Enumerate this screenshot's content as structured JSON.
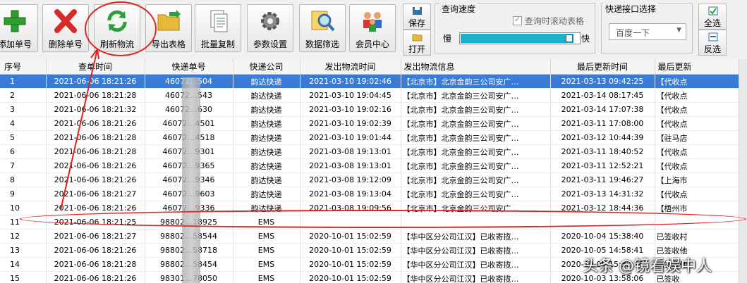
{
  "toolbar": {
    "buttons": [
      {
        "label": "添加单号",
        "icon": "plus-icon"
      },
      {
        "label": "删除单号",
        "icon": "x-icon"
      },
      {
        "label": "刷新物流",
        "icon": "refresh-icon"
      },
      {
        "label": "导出表格",
        "icon": "folder-export-icon"
      },
      {
        "label": "批量复制",
        "icon": "copy-icon"
      },
      {
        "label": "参数设置",
        "icon": "gear-icon"
      },
      {
        "label": "数据筛选",
        "icon": "magnifier-icon"
      },
      {
        "label": "会员中心",
        "icon": "members-icon"
      }
    ],
    "save_label": "保存",
    "open_label": "打开",
    "speed": {
      "title": "查询速度",
      "checkbox_label": "查询时滚动表格",
      "checked": true,
      "slow_label": "慢",
      "fast_label": "快",
      "level": 0.95
    },
    "interface": {
      "title": "快递接口选择",
      "selected": "百度一下"
    },
    "select_all_label": "全选",
    "invert_label": "反选"
  },
  "grid": {
    "headers": [
      "序号",
      "查单时间",
      "快递单号",
      "快递公司",
      "发出物流时间",
      "发出物流信息",
      "最后更新时间",
      "最后更新"
    ],
    "rows": [
      [
        "1",
        "2021-06-06 18:21:26",
        "46072…504",
        "韵达快递",
        "2021-03-10 19:02:46",
        "【北京市】北京金韵三公司安广…",
        "2021-03-13 09:42:25",
        "【代收点"
      ],
      [
        "2",
        "2021-06-06 18:21:28",
        "46072…543",
        "韵达快递",
        "2021-03-10 19:04:45",
        "【北京市】北京金韵三公司安广…",
        "2021-03-14 08:17:45",
        "【代收点"
      ],
      [
        "3",
        "2021-06-06 18:21:32",
        "46072…630",
        "韵达快递",
        "2021-03-10 19:02:16",
        "【北京市】北京金韵三公司安广…",
        "2021-03-14 17:07:38",
        "【代收点"
      ],
      [
        "4",
        "2021-06-06 18:21:26",
        "46072…4501",
        "韵达快递",
        "2021-03-10 19:02:39",
        "【北京市】北京金韵三公司安广…",
        "2021-03-11 17:08:00",
        "【代收点"
      ],
      [
        "5",
        "2021-06-06 18:21:28",
        "46072…4518",
        "韵达快递",
        "2021-03-10 19:01:44",
        "【北京市】北京金韵三公司安广…",
        "2021-03-12 10:44:39",
        "【驻马店"
      ],
      [
        "6",
        "2021-06-06 18:21:28",
        "46072…9301",
        "韵达快递",
        "2021-03-08 19:13:01",
        "【北京市】北京金韵三公司安广…",
        "2021-03-11 18:40:52",
        "【代收点"
      ],
      [
        "7",
        "2021-06-06 18:21:26",
        "46072…9365",
        "韵达快递",
        "2021-03-08 19:13:01",
        "【北京市】北京金韵三公司安广…",
        "2021-03-11 12:52:21",
        "【代收点"
      ],
      [
        "8",
        "2021-06-06 18:21:26",
        "46072…9346",
        "韵达快递",
        "2021-03-08 19:12:09",
        "【北京市】北京金韵三公司安广…",
        "2021-03-11 19:46:27",
        "【上海市"
      ],
      [
        "9",
        "2021-06-06 18:21:27",
        "46072…9603",
        "韵达快递",
        "2021-03-08 19:13:04",
        "【北京市】北京金韵三公司安广…",
        "2021-03-13 14:31:32",
        "【代收点"
      ],
      [
        "10",
        "2021-06-06 18:21:26",
        "46072…9336",
        "韵达快递",
        "2021-03-08 19:09:56",
        "【北京市】北京金韵三公司安广…",
        "2021-03-12 18:44:36",
        "【梧州市"
      ],
      [
        "11",
        "2021-06-06 18:21:25",
        "98802…18925",
        "EMS",
        "",
        "",
        "",
        ""
      ],
      [
        "12",
        "2021-06-06 18:21:27",
        "98802…58544",
        "EMS",
        "2020-10-01 15:02:59",
        "【华中区分公司江汉】已收寄揽…",
        "2020-10-04 15:38:40",
        "已签收村"
      ],
      [
        "13",
        "2021-06-06 18:21:26",
        "98802…58718",
        "EMS",
        "2020-10-01 15:02:59",
        "【华中区分公司江汉】已收寄揽…",
        "2020-10-05 14:58:41",
        "已签收他"
      ],
      [
        "14",
        "2021-06-06 18:21:28",
        "98802…58454",
        "EMS",
        "2020-10-01 15:02:59",
        "【华中区分公司江汉】已收寄揽…",
        "2020-10-05 15:32:16",
        "已签收他"
      ],
      [
        "15",
        "2021-06-06 18:21:26",
        "98301…78050",
        "EMS",
        "2020-10-01 15:02:59",
        "【华中区分公司江汉】已收寄揽…",
        "2020-10-03 13:58:06",
        "已签收"
      ]
    ]
  },
  "watermark": "头条 @镜看娱中人",
  "colors": {
    "selection": "#3a7bd5",
    "annotation": "#e02424",
    "progress": "#1ab0c8"
  }
}
